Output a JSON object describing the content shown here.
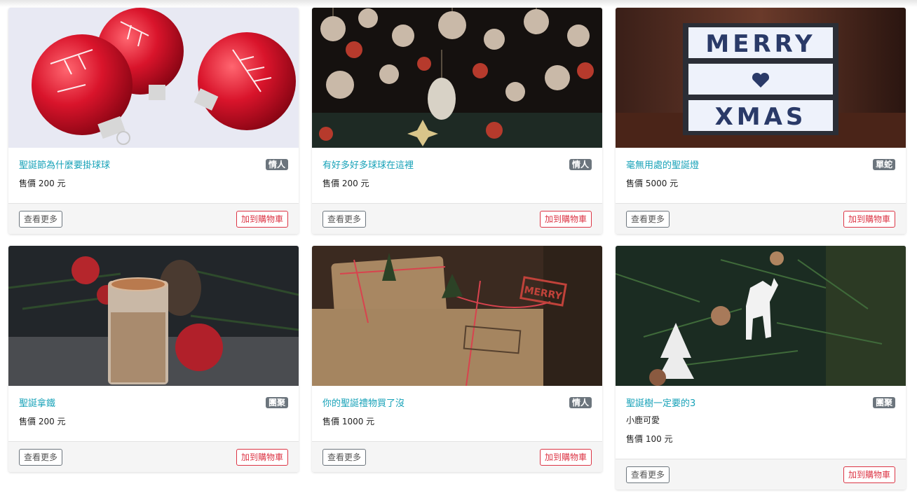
{
  "products": [
    {
      "title": "聖誕節為什麼要掛球球",
      "category": "情人",
      "price": "售價 200 元",
      "more_label": "查看更多",
      "cart_label": "加到購物車"
    },
    {
      "title": "有好多好多球球在這裡",
      "category": "情人",
      "price": "售價 200 元",
      "more_label": "查看更多",
      "cart_label": "加到購物車"
    },
    {
      "title": "毫無用處的聖誕燈",
      "category": "單蛇",
      "price": "售價 5000 元",
      "more_label": "查看更多",
      "cart_label": "加到購物車",
      "lightbox_text": [
        "MERRY",
        "XMAS"
      ]
    },
    {
      "title": "聖誕拿鐵",
      "category": "團聚",
      "price": "售價 200 元",
      "more_label": "查看更多",
      "cart_label": "加到購物車"
    },
    {
      "title": "你的聖誕禮物買了沒",
      "category": "情人",
      "price": "售價 1000 元",
      "more_label": "查看更多",
      "cart_label": "加到購物車",
      "stamp_text": "MERRY"
    },
    {
      "title": "聖誕樹一定要的3",
      "category": "團聚",
      "description": "小鹿可愛",
      "price": "售價 100 元",
      "more_label": "查看更多",
      "cart_label": "加到購物車"
    }
  ],
  "colors": {
    "link": "#17a2b8",
    "badge": "#6c757d",
    "danger": "#dc3545"
  }
}
